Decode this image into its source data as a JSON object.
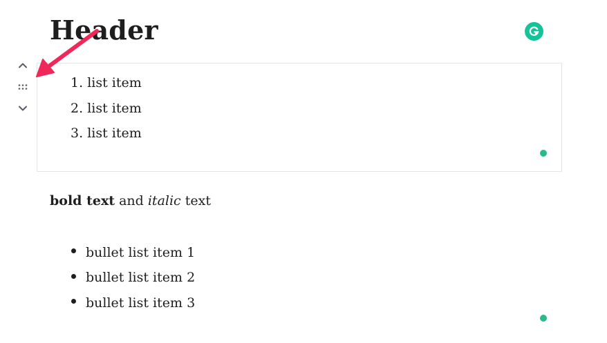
{
  "header": {
    "text": "Header"
  },
  "block_mover": {
    "icons": [
      "chevron-up-icon",
      "drag-handle-icon",
      "chevron-down-icon"
    ]
  },
  "ordered_list": {
    "items": [
      {
        "marker": "1.",
        "text": "list item"
      },
      {
        "marker": "2.",
        "text": "list item"
      },
      {
        "marker": "3.",
        "text": "list item"
      }
    ]
  },
  "paragraph": {
    "bold": "bold text",
    "middle": " and ",
    "italic": "italic",
    "end": " text"
  },
  "bullet_list": {
    "items": [
      {
        "text": "bullet list item 1"
      },
      {
        "text": "bullet list item 2"
      },
      {
        "text": "bullet list item 3"
      }
    ]
  },
  "colors": {
    "grammarly": "#15c39a",
    "arrow": "#f0285a",
    "block_border": "#e2e4e7"
  }
}
